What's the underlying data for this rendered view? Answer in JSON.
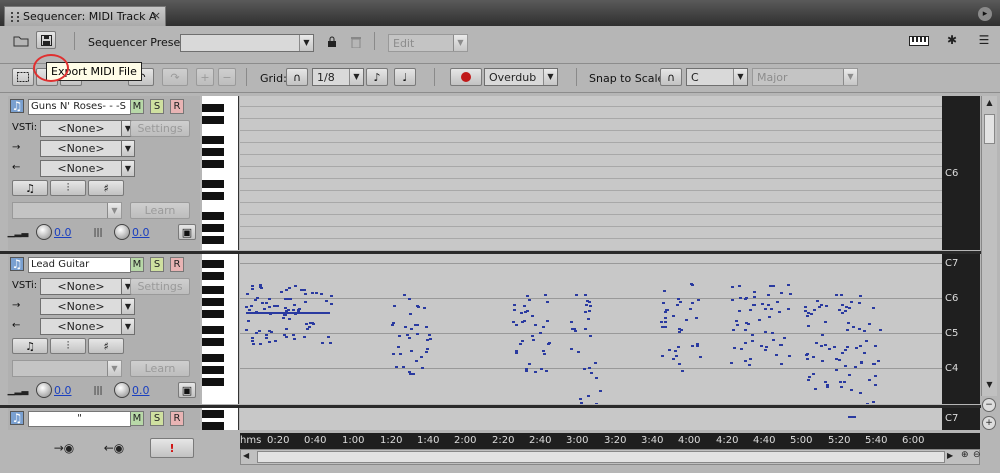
{
  "window": {
    "tab_title": "Sequencer: MIDI Track A",
    "close_glyph": "×"
  },
  "toolbar1": {
    "preset_label": "Sequencer Preset:",
    "preset_value": "",
    "edit_value": "Edit",
    "tooltip": "Export MIDI File"
  },
  "toolbar2": {
    "grid_label": "Grid:",
    "grid_value": "1/8",
    "record_mode": "Overdub",
    "snap_label": "Snap to Scale:",
    "scale_key": "C",
    "scale_mode": "Major"
  },
  "tracks": [
    {
      "name": "Guns N' Roses- - -S",
      "vsti_label": "VSTi:",
      "vsti_value": "<None>",
      "in_value": "<None>",
      "out_value": "<None>",
      "settings_label": "Settings",
      "learn_label": "Learn",
      "vol_value": "0.0",
      "pan_value": "0.0",
      "m": "M",
      "s": "S",
      "r": "R",
      "ruler_labels": [
        "C6"
      ]
    },
    {
      "name": "Lead Guitar",
      "vsti_label": "VSTi:",
      "vsti_value": "<None>",
      "in_value": "<None>",
      "out_value": "<None>",
      "settings_label": "Settings",
      "learn_label": "Learn",
      "vol_value": "0.0",
      "pan_value": "0.0",
      "m": "M",
      "s": "S",
      "r": "R",
      "ruler_labels": [
        "C7",
        "C6",
        "C5",
        "C4"
      ]
    },
    {
      "name": "\"",
      "m": "M",
      "s": "S",
      "r": "R",
      "ruler_labels": [
        "C7"
      ]
    }
  ],
  "timeline": {
    "unit": "hms",
    "ticks": [
      "0:20",
      "0:40",
      "1:00",
      "1:20",
      "1:40",
      "2:00",
      "2:20",
      "2:40",
      "3:00",
      "3:20",
      "3:40",
      "4:00",
      "4:20",
      "4:40",
      "5:00",
      "5:20",
      "5:40",
      "6:00"
    ]
  },
  "bottom": {
    "alert_glyph": "!"
  },
  "icons": [
    "folder-icon",
    "save-icon",
    "lock-icon",
    "trash-icon",
    "piano-icon",
    "gear-icon",
    "list-icon",
    "marquee-select-icon",
    "pencil-icon",
    "undo-icon",
    "redo-icon",
    "plus-icon",
    "minus-icon",
    "magnet-icon",
    "record-icon",
    "note-icon"
  ]
}
